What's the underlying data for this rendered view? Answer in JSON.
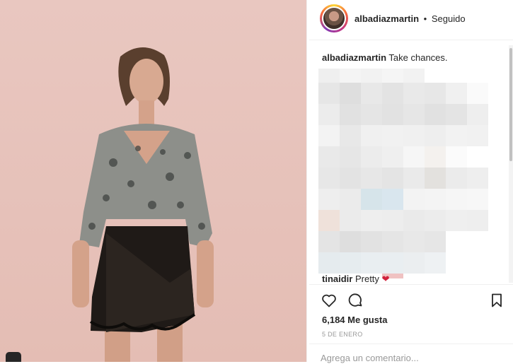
{
  "header": {
    "username": "albadiazmartin",
    "separator": "•",
    "follow_state": "Seguido"
  },
  "caption": {
    "username": "albadiazmartin",
    "text": "Take chances."
  },
  "last_comment": {
    "username": "tinaidir",
    "text": "Pretty",
    "emoji": "❤"
  },
  "actions": {
    "like_icon": "heart-icon",
    "comment_icon": "comment-bubble-icon",
    "save_icon": "bookmark-icon"
  },
  "likes": "6,184 Me gusta",
  "date": "5 DE ENERO",
  "comment_box": {
    "placeholder": "Agrega un comentario..."
  },
  "colors": {
    "text": "#262626",
    "muted": "#999999",
    "divider": "#efefef",
    "photo_background": "#e9c7c0"
  }
}
